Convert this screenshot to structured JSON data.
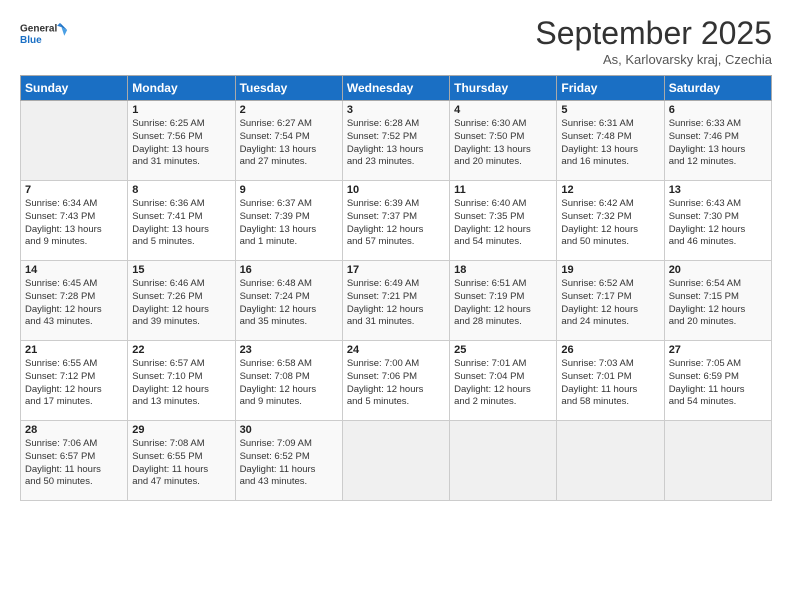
{
  "header": {
    "logo_line1": "General",
    "logo_line2": "Blue",
    "month_title": "September 2025",
    "subtitle": "As, Karlovarsky kraj, Czechia"
  },
  "days_of_week": [
    "Sunday",
    "Monday",
    "Tuesday",
    "Wednesday",
    "Thursday",
    "Friday",
    "Saturday"
  ],
  "weeks": [
    [
      {
        "day": "",
        "text": ""
      },
      {
        "day": "1",
        "text": "Sunrise: 6:25 AM\nSunset: 7:56 PM\nDaylight: 13 hours\nand 31 minutes."
      },
      {
        "day": "2",
        "text": "Sunrise: 6:27 AM\nSunset: 7:54 PM\nDaylight: 13 hours\nand 27 minutes."
      },
      {
        "day": "3",
        "text": "Sunrise: 6:28 AM\nSunset: 7:52 PM\nDaylight: 13 hours\nand 23 minutes."
      },
      {
        "day": "4",
        "text": "Sunrise: 6:30 AM\nSunset: 7:50 PM\nDaylight: 13 hours\nand 20 minutes."
      },
      {
        "day": "5",
        "text": "Sunrise: 6:31 AM\nSunset: 7:48 PM\nDaylight: 13 hours\nand 16 minutes."
      },
      {
        "day": "6",
        "text": "Sunrise: 6:33 AM\nSunset: 7:46 PM\nDaylight: 13 hours\nand 12 minutes."
      }
    ],
    [
      {
        "day": "7",
        "text": "Sunrise: 6:34 AM\nSunset: 7:43 PM\nDaylight: 13 hours\nand 9 minutes."
      },
      {
        "day": "8",
        "text": "Sunrise: 6:36 AM\nSunset: 7:41 PM\nDaylight: 13 hours\nand 5 minutes."
      },
      {
        "day": "9",
        "text": "Sunrise: 6:37 AM\nSunset: 7:39 PM\nDaylight: 13 hours\nand 1 minute."
      },
      {
        "day": "10",
        "text": "Sunrise: 6:39 AM\nSunset: 7:37 PM\nDaylight: 12 hours\nand 57 minutes."
      },
      {
        "day": "11",
        "text": "Sunrise: 6:40 AM\nSunset: 7:35 PM\nDaylight: 12 hours\nand 54 minutes."
      },
      {
        "day": "12",
        "text": "Sunrise: 6:42 AM\nSunset: 7:32 PM\nDaylight: 12 hours\nand 50 minutes."
      },
      {
        "day": "13",
        "text": "Sunrise: 6:43 AM\nSunset: 7:30 PM\nDaylight: 12 hours\nand 46 minutes."
      }
    ],
    [
      {
        "day": "14",
        "text": "Sunrise: 6:45 AM\nSunset: 7:28 PM\nDaylight: 12 hours\nand 43 minutes."
      },
      {
        "day": "15",
        "text": "Sunrise: 6:46 AM\nSunset: 7:26 PM\nDaylight: 12 hours\nand 39 minutes."
      },
      {
        "day": "16",
        "text": "Sunrise: 6:48 AM\nSunset: 7:24 PM\nDaylight: 12 hours\nand 35 minutes."
      },
      {
        "day": "17",
        "text": "Sunrise: 6:49 AM\nSunset: 7:21 PM\nDaylight: 12 hours\nand 31 minutes."
      },
      {
        "day": "18",
        "text": "Sunrise: 6:51 AM\nSunset: 7:19 PM\nDaylight: 12 hours\nand 28 minutes."
      },
      {
        "day": "19",
        "text": "Sunrise: 6:52 AM\nSunset: 7:17 PM\nDaylight: 12 hours\nand 24 minutes."
      },
      {
        "day": "20",
        "text": "Sunrise: 6:54 AM\nSunset: 7:15 PM\nDaylight: 12 hours\nand 20 minutes."
      }
    ],
    [
      {
        "day": "21",
        "text": "Sunrise: 6:55 AM\nSunset: 7:12 PM\nDaylight: 12 hours\nand 17 minutes."
      },
      {
        "day": "22",
        "text": "Sunrise: 6:57 AM\nSunset: 7:10 PM\nDaylight: 12 hours\nand 13 minutes."
      },
      {
        "day": "23",
        "text": "Sunrise: 6:58 AM\nSunset: 7:08 PM\nDaylight: 12 hours\nand 9 minutes."
      },
      {
        "day": "24",
        "text": "Sunrise: 7:00 AM\nSunset: 7:06 PM\nDaylight: 12 hours\nand 5 minutes."
      },
      {
        "day": "25",
        "text": "Sunrise: 7:01 AM\nSunset: 7:04 PM\nDaylight: 12 hours\nand 2 minutes."
      },
      {
        "day": "26",
        "text": "Sunrise: 7:03 AM\nSunset: 7:01 PM\nDaylight: 11 hours\nand 58 minutes."
      },
      {
        "day": "27",
        "text": "Sunrise: 7:05 AM\nSunset: 6:59 PM\nDaylight: 11 hours\nand 54 minutes."
      }
    ],
    [
      {
        "day": "28",
        "text": "Sunrise: 7:06 AM\nSunset: 6:57 PM\nDaylight: 11 hours\nand 50 minutes."
      },
      {
        "day": "29",
        "text": "Sunrise: 7:08 AM\nSunset: 6:55 PM\nDaylight: 11 hours\nand 47 minutes."
      },
      {
        "day": "30",
        "text": "Sunrise: 7:09 AM\nSunset: 6:52 PM\nDaylight: 11 hours\nand 43 minutes."
      },
      {
        "day": "",
        "text": ""
      },
      {
        "day": "",
        "text": ""
      },
      {
        "day": "",
        "text": ""
      },
      {
        "day": "",
        "text": ""
      }
    ]
  ]
}
